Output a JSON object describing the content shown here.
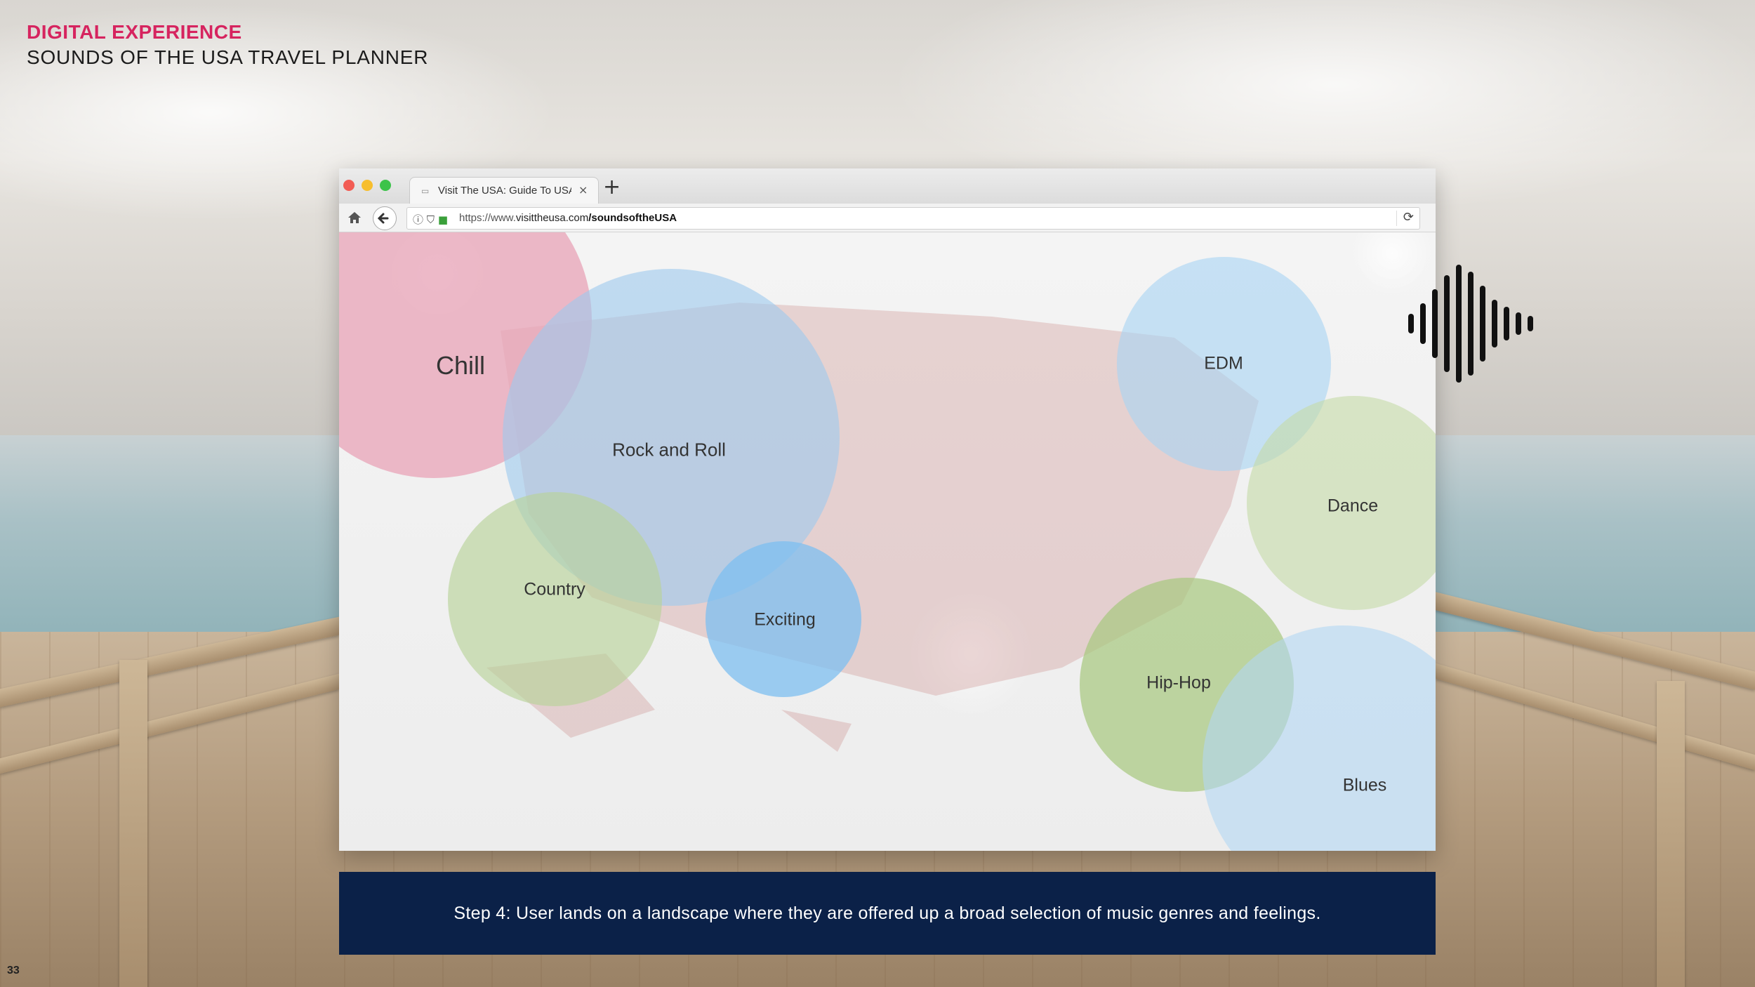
{
  "heading": {
    "kicker": "DIGITAL EXPERIENCE",
    "title": "SOUNDS OF THE USA TRAVEL PLANNER"
  },
  "page_number": "33",
  "browser": {
    "tab_title": "Visit The USA: Guide To USA",
    "tab_close": "×",
    "new_tab": "+",
    "url_prefix": "https://www.",
    "url_domain": "visittheusa.com",
    "url_path": "/soundsoftheUSA"
  },
  "genres": [
    {
      "label": "Chill",
      "color": "#e8a3b7"
    },
    {
      "label": "Rock and Roll",
      "color": "#9cc9ee"
    },
    {
      "label": "Country",
      "color": "#b9d39a"
    },
    {
      "label": "Exciting",
      "color": "#7ebff0"
    },
    {
      "label": "EDM",
      "color": "#a7d3f3"
    },
    {
      "label": "Dance",
      "color": "#c4dba6"
    },
    {
      "label": "Hip-Hop",
      "color": "#a6c77d"
    },
    {
      "label": "Blues",
      "color": "#b3d7f3"
    }
  ],
  "caption": "Step 4: User lands on a landscape where they are offered up a broad selection of music genres and feelings.",
  "icons": {
    "home": "home-icon",
    "back": "back-arrow-icon",
    "info": "info-icon",
    "shield": "shield-icon",
    "lock": "lock-icon",
    "reload": "reload-icon",
    "audio": "sound-wave-icon"
  }
}
